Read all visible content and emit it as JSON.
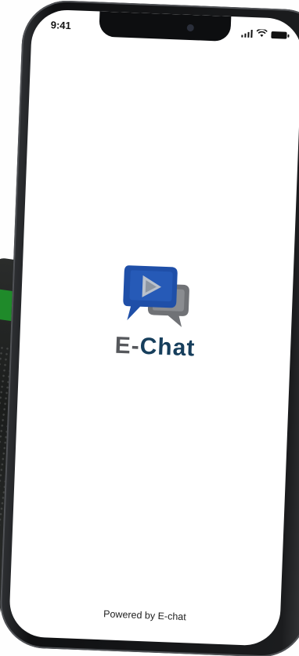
{
  "status_bar": {
    "time": "9:41",
    "signal_icon": "cellular-signal-icon",
    "wifi_icon": "wifi-icon",
    "battery_icon": "battery-icon"
  },
  "splash": {
    "logo_icon": "chat-video-bubbles-icon",
    "app_name_prefix": "E-",
    "app_name_suffix": "Chat",
    "footer": "Powered by E-chat"
  },
  "colors": {
    "brand_blue": "#1f4fa8",
    "brand_navy": "#163e5c",
    "brand_gray": "#56585c",
    "background": "#ffffff"
  }
}
